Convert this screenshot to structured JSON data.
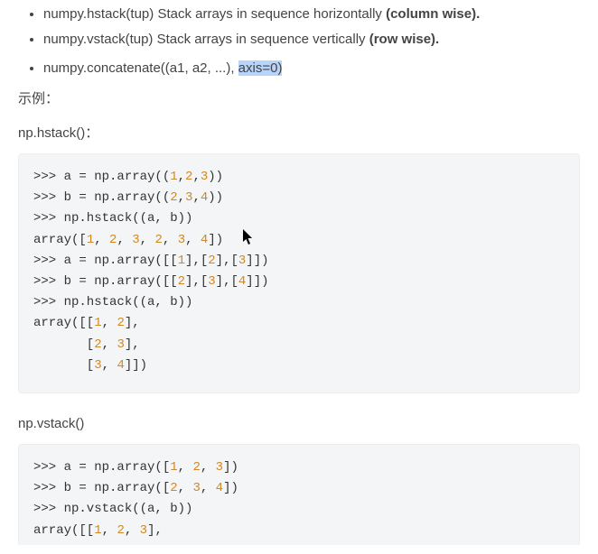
{
  "bullets": {
    "b1_prefix": "numpy.hstack(tup) Stack arrays in sequence horizontally ",
    "b1_bold": "(column wise).",
    "b2_prefix": "numpy.vstack(tup) Stack arrays in sequence vertically ",
    "b2_bold": "(row wise).",
    "b3_prefix": "numpy.concatenate((a1, a2, ...), ",
    "b3_hl": "axis=0)"
  },
  "labels": {
    "example": "示例：",
    "hstack": "np.hstack()：",
    "vstack": "np.vstack()"
  },
  "code1": {
    "l1a": ">>> a = np.array((",
    "l1n1": "1",
    "l1c1": ",",
    "l1n2": "2",
    "l1c2": ",",
    "l1n3": "3",
    "l1b": "))",
    "l2a": ">>> b = np.array((",
    "l2n1": "2",
    "l2c1": ",",
    "l2n2": "3",
    "l2c2": ",",
    "l2n3": "4",
    "l2b": "))",
    "l3": ">>> np.hstack((a, b))",
    "l4a": "array([",
    "l4n1": "1",
    "lc": ", ",
    "l4n2": "2",
    "l4n3": "3",
    "l4n4": "2",
    "l4n5": "3",
    "l4n6": "4",
    "l4b": "])",
    "l5a": ">>> a = np.array([[",
    "l5n1": "1",
    "l5m": "],[",
    "l5n2": "2",
    "l5n3": "3",
    "l5b": "]])",
    "l6a": ">>> b = np.array([[",
    "l6n1": "2",
    "l6n2": "3",
    "l6n3": "4",
    "l6b": "]])",
    "l7": ">>> np.hstack((a, b))",
    "l8a": "array([[",
    "l8n1": "1",
    "l8n2": "2",
    "l8b": "],",
    "l9a": "       [",
    "l9n1": "2",
    "l9n2": "3",
    "l9b": "],",
    "l10a": "       [",
    "l10n1": "3",
    "l10n2": "4",
    "l10b": "]])"
  },
  "code2": {
    "l1a": ">>> a = np.array([",
    "l1n1": "1",
    "lc": ", ",
    "l1n2": "2",
    "l1n3": "3",
    "l1b": "])",
    "l2a": ">>> b = np.array([",
    "l2n1": "2",
    "l2n2": "3",
    "l2n3": "4",
    "l2b": "])",
    "l3": ">>> np.vstack((a, b))",
    "l4a": "array([[",
    "l4n1": "1",
    "l4n2": "2",
    "l4n3": "3",
    "l4b": "],"
  }
}
